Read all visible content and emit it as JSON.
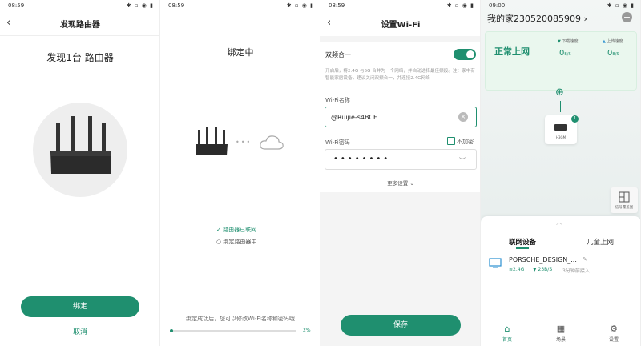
{
  "status_times": [
    "08:59",
    "08:59",
    "08:59",
    "09:00"
  ],
  "status_icons": "✱ ▫ ◉ ▮",
  "colors": {
    "accent": "#1f8f6f",
    "progress": "#1f8f6f"
  },
  "phone1": {
    "title": "发现路由器",
    "headline": "发现1台 路由器",
    "bind_button": "绑定",
    "cancel_link": "取消"
  },
  "phone2": {
    "title": "绑定中",
    "steps": [
      "路由器已联网",
      "绑定路由器中..."
    ],
    "hint": "绑定成功后，您可以修改Wi-Fi名称和密码哦",
    "progress_percent": 2,
    "progress_label": "2%"
  },
  "phone3": {
    "title": "设置Wi-Fi",
    "dual_band_label": "双频合一",
    "dual_band_enabled": true,
    "dual_band_desc": "开启后，将2.4G 与5G 合并为一个网络，并自动选择最佳频段。注：家中有智能家居设备，建议关闭双频合一，并连接2.4G网络",
    "ssid_label": "Wi-Fi名称",
    "ssid_value": "@Ruijie-s4BCF",
    "password_label": "Wi-Fi密码",
    "no_password_label": "不加密",
    "password_mask": "••••••••",
    "more_settings": "更多设置",
    "save_button": "保存"
  },
  "phone4": {
    "home_title": "我的家230520085909",
    "status": "正常上网",
    "download_label": "下载速度",
    "download_value": "0",
    "download_unit": "B/S",
    "upload_label": "上传速度",
    "upload_value": "0",
    "upload_unit": "B/S",
    "router_label": "H3GM",
    "router_badge": "1",
    "coverage_label": "信号覆盖图",
    "tabs": [
      "联网设备",
      "儿童上网"
    ],
    "device": {
      "name": "PORSCHE_DESIGN_...",
      "band": "2.4G",
      "rate": "23B/S",
      "connected": "3分钟前接入"
    },
    "nav": [
      "首页",
      "场景",
      "设置"
    ]
  }
}
